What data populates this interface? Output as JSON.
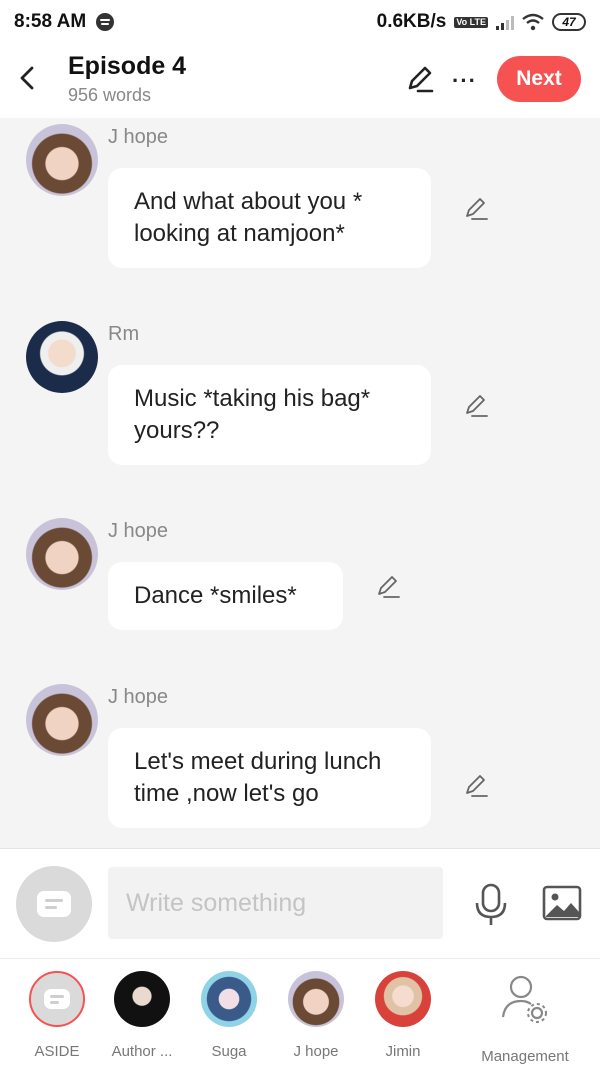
{
  "status": {
    "time": "8:58 AM",
    "speed": "0.6KB/s",
    "volte": "Vo LTE",
    "battery": "47"
  },
  "header": {
    "title": "Episode 4",
    "word_count": "956 words",
    "next_label": "Next",
    "more_label": "···"
  },
  "messages": [
    {
      "speaker": "J hope",
      "text": "And what about you * looking at namjoon*",
      "avatar": "j-hope"
    },
    {
      "speaker": "Rm",
      "text": "Music *taking his bag* yours??",
      "avatar": "rm"
    },
    {
      "speaker": "J hope",
      "text": "Dance *smiles*",
      "avatar": "j-hope"
    },
    {
      "speaker": "J hope",
      "text": "Let's meet during lunch time ,now let's go",
      "avatar": "j-hope"
    }
  ],
  "composer": {
    "placeholder": "Write something",
    "icons": [
      "aside-note-icon",
      "microphone-icon",
      "image-icon"
    ]
  },
  "characters": [
    {
      "label": "ASIDE",
      "selected": true
    },
    {
      "label": "Author ..."
    },
    {
      "label": "Suga"
    },
    {
      "label": "J hope"
    },
    {
      "label": "Jimin"
    },
    {
      "label": "Management"
    }
  ],
  "colors": {
    "accent": "#f65252",
    "background": "#f4f4f4",
    "bubble": "#ffffff",
    "muted_text": "#888888"
  }
}
